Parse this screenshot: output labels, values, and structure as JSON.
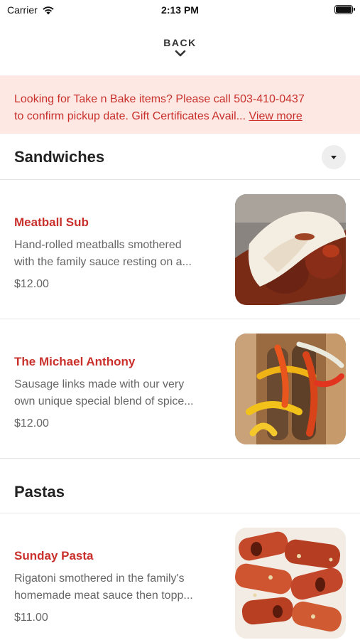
{
  "status_bar": {
    "carrier": "Carrier",
    "time": "2:13 PM"
  },
  "nav": {
    "back_label": "BACK"
  },
  "banner": {
    "line1": "Looking for Take n Bake items? Please call 503-410-0437",
    "line2": "to confirm pickup date. Gift Certificates Avail...",
    "link": "View more"
  },
  "sections": [
    {
      "title": "Sandwiches",
      "items": [
        {
          "name": "Meatball Sub",
          "desc_line1": "Hand-rolled meatballs smothered",
          "desc_line2": "with the family sauce resting on a...",
          "price": "$12.00",
          "photo": "meatball-sub-photo"
        },
        {
          "name": "The Michael Anthony",
          "desc_line1": "Sausage links made with our very",
          "desc_line2": "own unique special blend of spice...",
          "price": "$12.00",
          "photo": "sausage-peppers-sub-photo"
        }
      ]
    },
    {
      "title": "Pastas",
      "items": [
        {
          "name": "Sunday Pasta",
          "desc_line1": "Rigatoni smothered in the family's",
          "desc_line2": "homemade meat sauce then topp...",
          "price": "$11.00",
          "photo": "rigatoni-pasta-photo"
        }
      ]
    }
  ],
  "colors": {
    "accent": "#c9302c",
    "banner_bg": "#fde8e4"
  },
  "icons": [
    "wifi-icon",
    "battery-icon",
    "chevron-down-icon",
    "caret-down-icon"
  ]
}
